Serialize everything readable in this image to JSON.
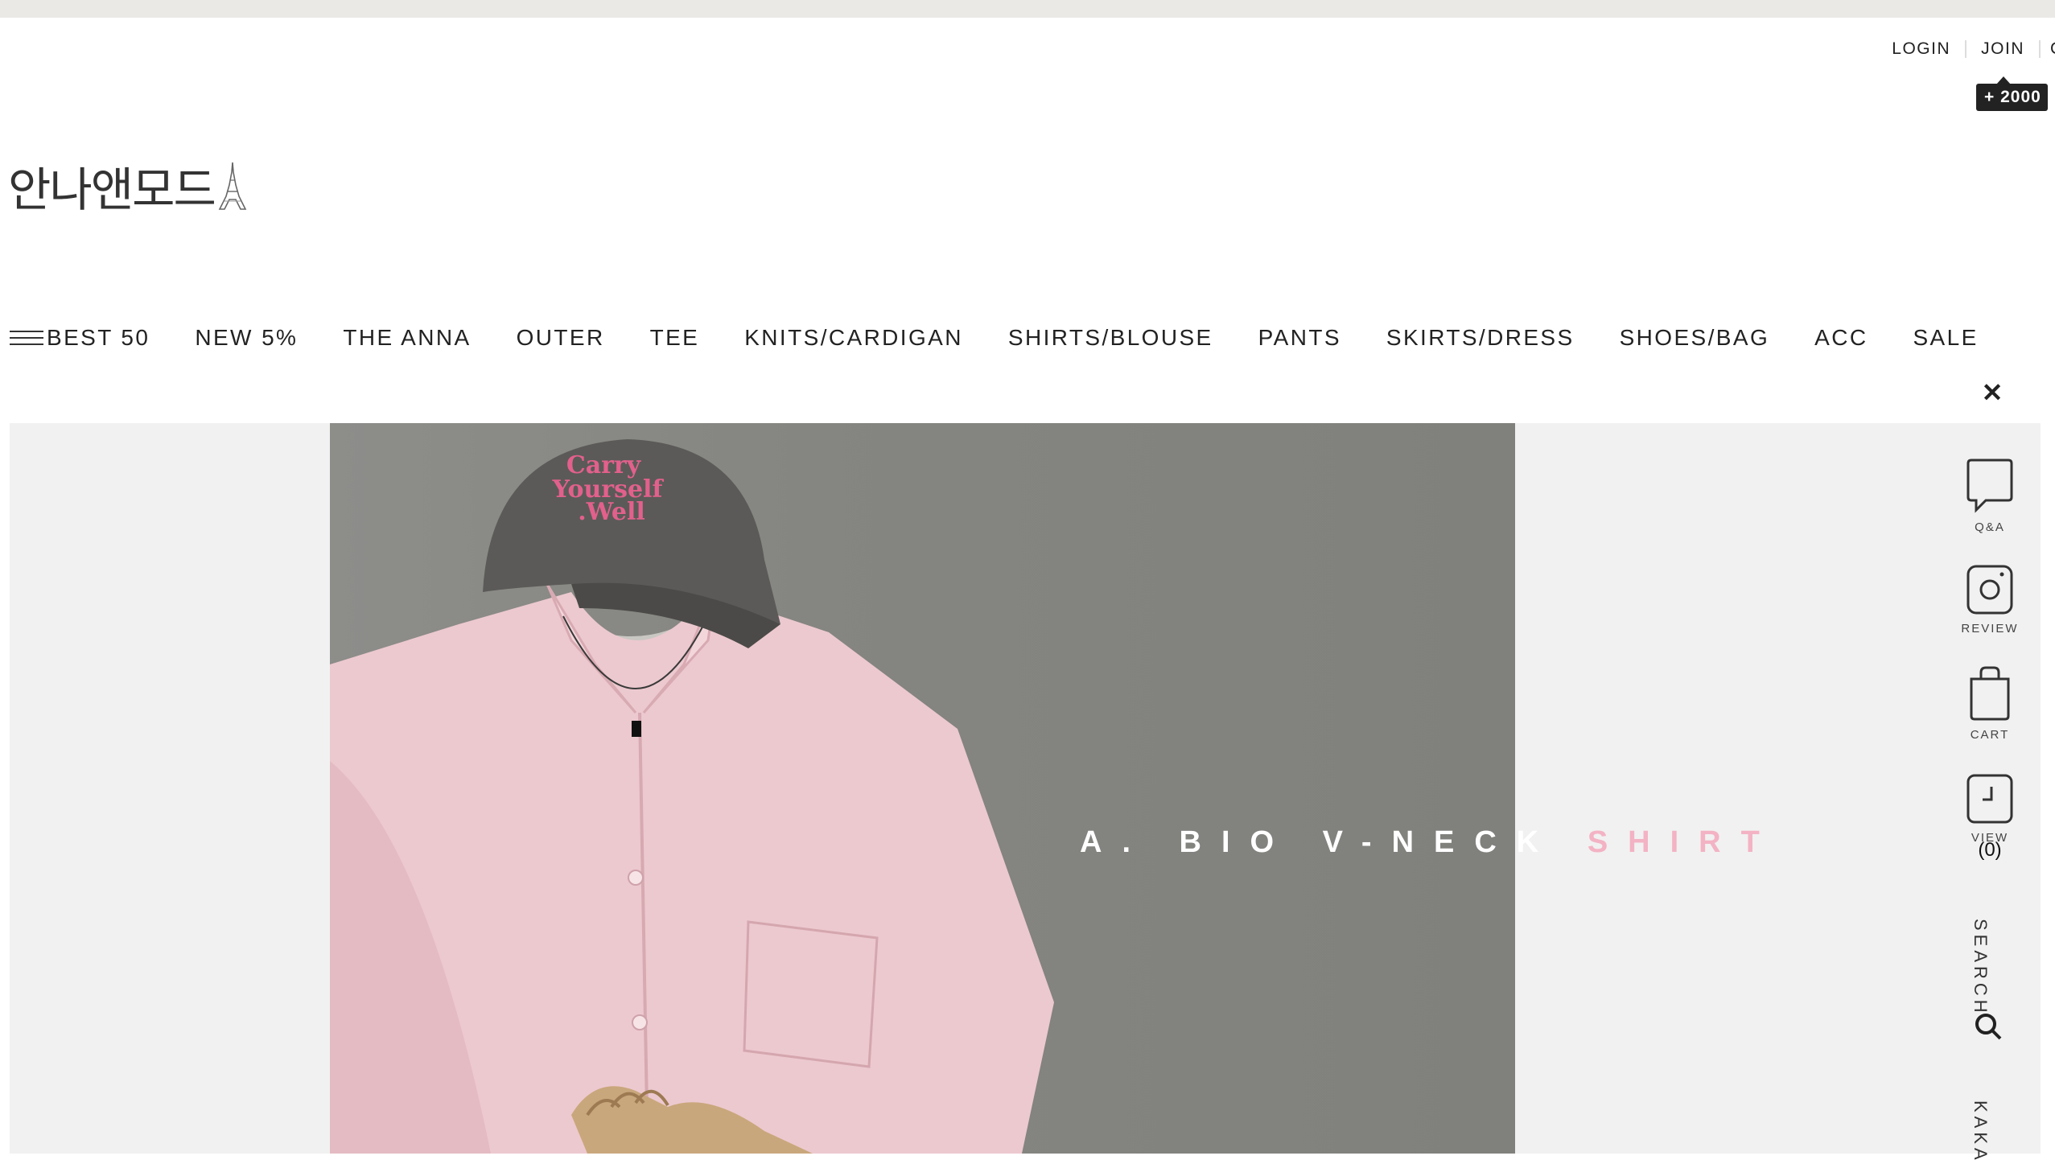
{
  "header": {
    "login_label": "LOGIN",
    "join_label": "JOIN",
    "truncated_link": "C",
    "join_bonus_badge": "+ 2000",
    "logo_text": "안나앤모드"
  },
  "nav": {
    "menu_icon": "hamburger-menu-icon",
    "items": [
      "BEST 50",
      "NEW 5%",
      "THE ANNA",
      "OUTER",
      "TEE",
      "KNITS/CARDIGAN",
      "SHIRTS/BLOUSE",
      "PANTS",
      "SKIRTS/DRESS",
      "SHOES/BAG",
      "ACC",
      "SALE"
    ]
  },
  "banner": {
    "close_icon": "close-icon",
    "headline_white": "A. BIO V-NECK",
    "headline_pink": "SHIRT",
    "cap_text_line1": "Carry",
    "cap_text_line2": "Yourself",
    "cap_text_line3": ".Well"
  },
  "quick_menu": {
    "qa_label": "Q&A",
    "review_label": "REVIEW",
    "cart_label": "CART",
    "view_label": "VIEW",
    "view_count": "(0)",
    "search_label": "SEARCH",
    "kakao_label": "KAKA"
  },
  "colors": {
    "accent_pink": "#f3b3c4",
    "badge_bg": "#222222",
    "banner_bg": "#f1f1f1"
  }
}
